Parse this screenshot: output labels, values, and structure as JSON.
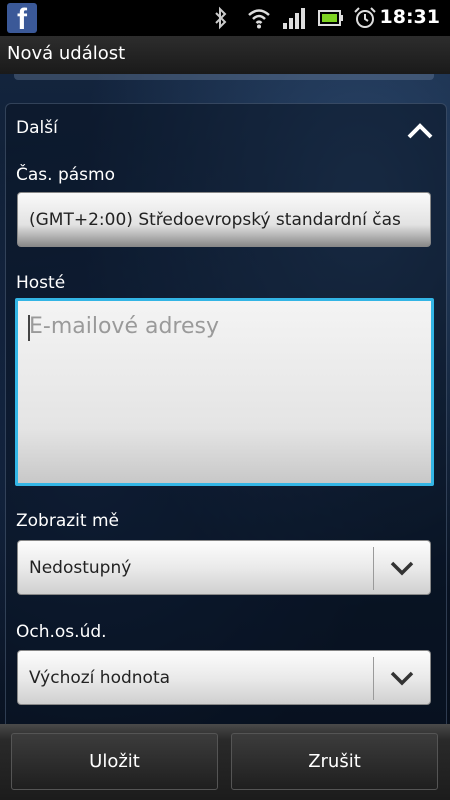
{
  "status_bar": {
    "app_icon": "facebook-icon",
    "icons": [
      "bluetooth-icon",
      "wifi-icon",
      "signal-icon",
      "battery-icon",
      "alarm-icon"
    ],
    "time": "18:31"
  },
  "header": {
    "title": "Nová událost"
  },
  "section": {
    "title": "Další",
    "collapse_icon": "chevron-up-icon"
  },
  "timezone": {
    "label": "Čas. pásmo",
    "value": "(GMT+2:00) Středoevropský standardní čas"
  },
  "guests": {
    "label": "Hosté",
    "placeholder": "E-mailové adresy",
    "value": ""
  },
  "show_me_as": {
    "label": "Zobrazit mě",
    "value": "Nedostupný"
  },
  "privacy": {
    "label": "Och.os.úd.",
    "value": "Výchozí hodnota"
  },
  "actions": {
    "save": "Uložit",
    "cancel": "Zrušit"
  },
  "colors": {
    "focus": "#33b5e5",
    "facebook": "#3b5998"
  }
}
